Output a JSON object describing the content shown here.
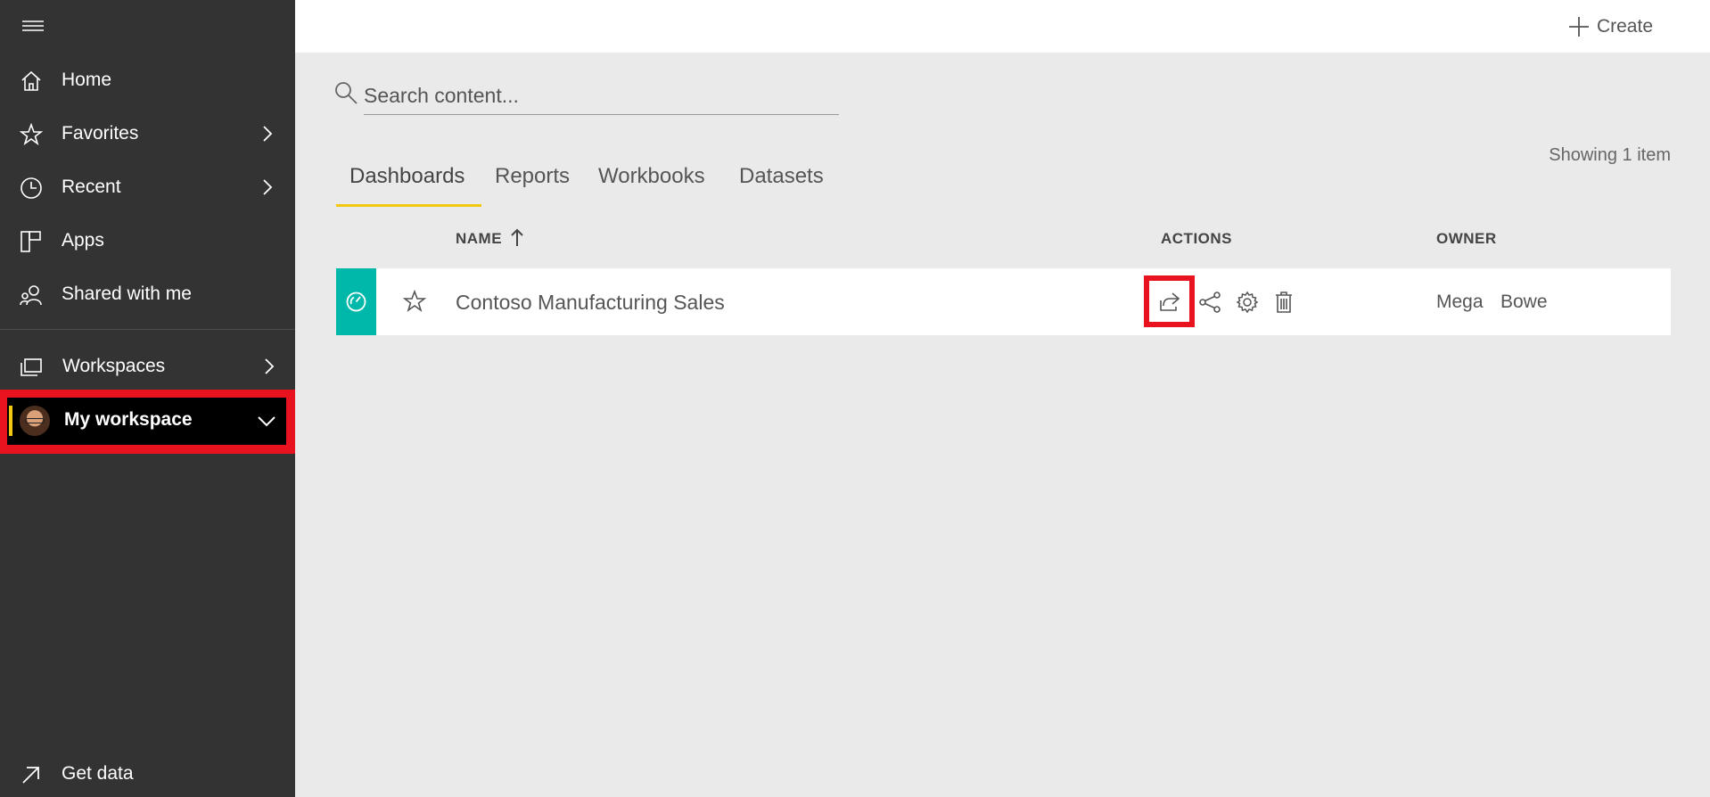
{
  "sidebar": {
    "items": [
      {
        "label": "Home",
        "icon": "home-icon"
      },
      {
        "label": "Favorites",
        "icon": "star-icon"
      },
      {
        "label": "Recent",
        "icon": "clock-icon"
      },
      {
        "label": "Apps",
        "icon": "apps-icon"
      },
      {
        "label": "Shared with me",
        "icon": "shared-icon"
      },
      {
        "label": "Workspaces",
        "icon": "workspaces-icon"
      }
    ],
    "my_workspace": "My workspace",
    "get_data": "Get data"
  },
  "topbar": {
    "create_label": "Create"
  },
  "search": {
    "placeholder": "Search content..."
  },
  "tabs": [
    "Dashboards",
    "Reports",
    "Workbooks",
    "Datasets"
  ],
  "showing": "Showing 1 item",
  "table": {
    "headers": {
      "name": "NAME",
      "actions": "ACTIONS",
      "owner": "OWNER"
    },
    "rows": [
      {
        "name": "Contoso Manufacturing Sales",
        "owner_first": "Mega",
        "owner_last": "Bowe"
      }
    ]
  },
  "colors": {
    "sidebar_bg": "#333333",
    "accent_yellow": "#f2c811",
    "highlight_red": "#e8131f",
    "tile_teal": "#00b8aa"
  }
}
